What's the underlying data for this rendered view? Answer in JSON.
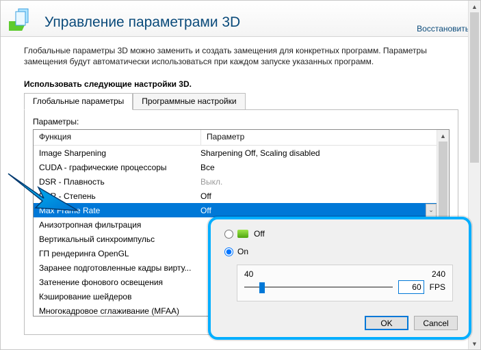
{
  "header": {
    "title": "Управление параметрами 3D",
    "restore": "Восстановить"
  },
  "intro": "Глобальные параметры 3D можно заменить и создать замещения для конкретных программ. Параметры замещения будут автоматически использоваться при каждом запуске указанных программ.",
  "section_title": "Использовать следующие настройки 3D.",
  "tabs": {
    "global": "Глобальные параметры",
    "program": "Программные настройки"
  },
  "params_label": "Параметры:",
  "columns": {
    "func": "Функция",
    "val": "Параметр"
  },
  "rows": [
    {
      "name": "Image Sharpening",
      "value": "Sharpening Off, Scaling disabled",
      "dim": false
    },
    {
      "name": "CUDA - графические процессоры",
      "value": "Все",
      "dim": false
    },
    {
      "name": "DSR - Плавность",
      "value": "Выкл.",
      "dim": true
    },
    {
      "name": "DSR - Степень",
      "value": "Off",
      "dim": false
    },
    {
      "name": "Max Frame Rate",
      "value": "Off",
      "dim": false,
      "selected": true,
      "dropdown": true
    },
    {
      "name": "Анизотропная фильтрация",
      "value": "",
      "dim": false
    },
    {
      "name": "Вертикальный синхроимпульс",
      "value": "",
      "dim": false
    },
    {
      "name": "ГП рендеринга OpenGL",
      "value": "",
      "dim": false
    },
    {
      "name": "Заранее подготовленные кадры вирту...",
      "value": "",
      "dim": false
    },
    {
      "name": "Затенение фонового освещения",
      "value": "",
      "dim": false
    },
    {
      "name": "Кэширование шейдеров",
      "value": "",
      "dim": false
    },
    {
      "name": "Многокадровое сглаживание (MFAA)",
      "value": "",
      "dim": false
    }
  ],
  "popup": {
    "off_label": "Off",
    "on_label": "On",
    "min": "40",
    "max": "240",
    "value": "60",
    "unit": "FPS",
    "ok": "OK",
    "cancel": "Cancel"
  }
}
